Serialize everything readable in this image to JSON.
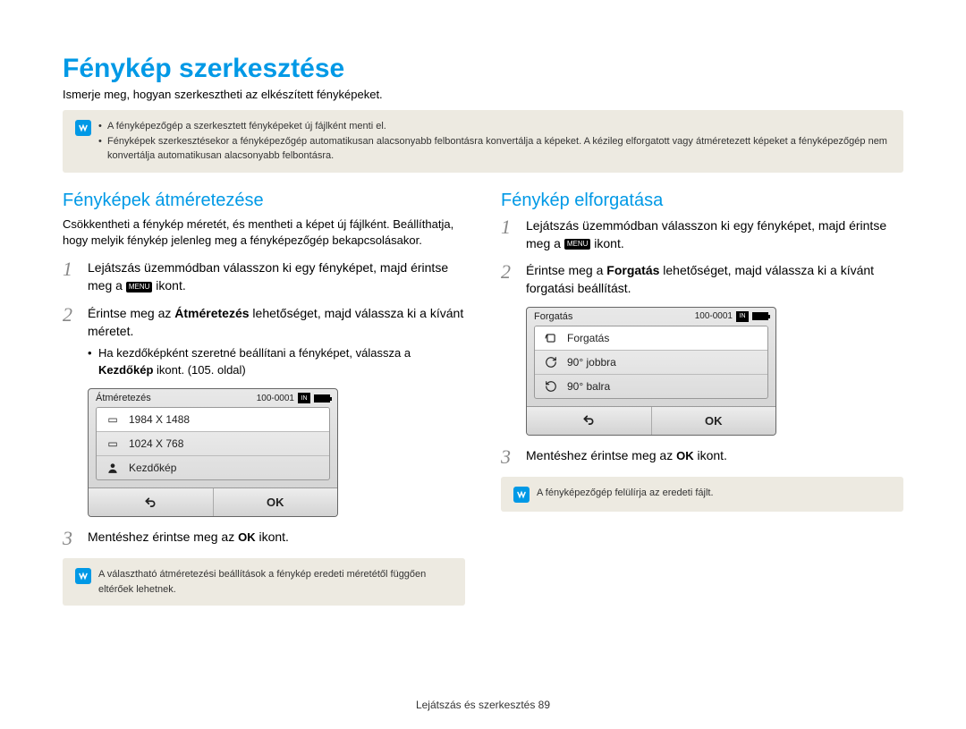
{
  "page_title": "Fénykép szerkesztése",
  "subtitle": "Ismerje meg, hogyan szerkesztheti az elkészített fényképeket.",
  "top_notes": [
    "A fényképezőgép a szerkesztett fényképeket új fájlként menti el.",
    "Fényképek szerkesztésekor a fényképezőgép automatikusan alacsonyabb felbontásra konvertálja a képeket. A kézileg elforgatott vagy átméretezett képeket a fényképezőgép nem konvertálja automatikusan alacsonyabb felbontásra."
  ],
  "left": {
    "heading": "Fényképek átméretezése",
    "lead": "Csökkentheti a fénykép méretét, és mentheti a képet új fájlként. Beállíthatja, hogy melyik fénykép jelenleg meg a fényképezőgép bekapcsolásakor.",
    "step1_a": "Lejátszás üzemmódban válasszon ki egy fényképet, majd érintse meg a ",
    "step1_b": " ikont.",
    "step2_a": "Érintse meg az ",
    "step2_bold": "Átméretezés",
    "step2_b": " lehetőséget, majd válassza ki a kívánt méretet.",
    "step2_bullet_a": "Ha kezdőképként szeretné beállítani a fényképet, válassza a ",
    "step2_bullet_bold": "Kezdőkép",
    "step2_bullet_b": " ikont. (105. oldal)",
    "step3_a": "Mentéshez érintse meg az ",
    "step3_b": " ikont.",
    "note": "A választható átméretezési beállítások a fénykép eredeti méretétől függően eltérőek lehetnek.",
    "device": {
      "title": "Átméretezés",
      "counter": "100-0001",
      "rows": [
        {
          "label": "1984 X 1488",
          "selected": true
        },
        {
          "label": "1024 X 768",
          "selected": false
        },
        {
          "label": "Kezdőkép",
          "selected": false
        }
      ],
      "ok": "OK"
    }
  },
  "right": {
    "heading": "Fénykép elforgatása",
    "step1_a": "Lejátszás üzemmódban válasszon ki egy fényképet, majd érintse meg a ",
    "step1_b": " ikont.",
    "step2_a": "Érintse meg a ",
    "step2_bold": "Forgatás",
    "step2_b": " lehetőséget, majd válassza ki a kívánt forgatási beállítást.",
    "step3_a": "Mentéshez érintse meg az ",
    "step3_b": " ikont.",
    "note": "A fényképezőgép felülírja az eredeti fájlt.",
    "device": {
      "title": "Forgatás",
      "counter": "100-0001",
      "rows": [
        {
          "label": "Forgatás",
          "selected": true
        },
        {
          "label": "90° jobbra",
          "selected": false
        },
        {
          "label": "90° balra",
          "selected": false
        }
      ],
      "ok": "OK"
    }
  },
  "menu_label": "MENU",
  "ok_label": "OK",
  "footer": "Lejátszás és szerkesztés  89"
}
